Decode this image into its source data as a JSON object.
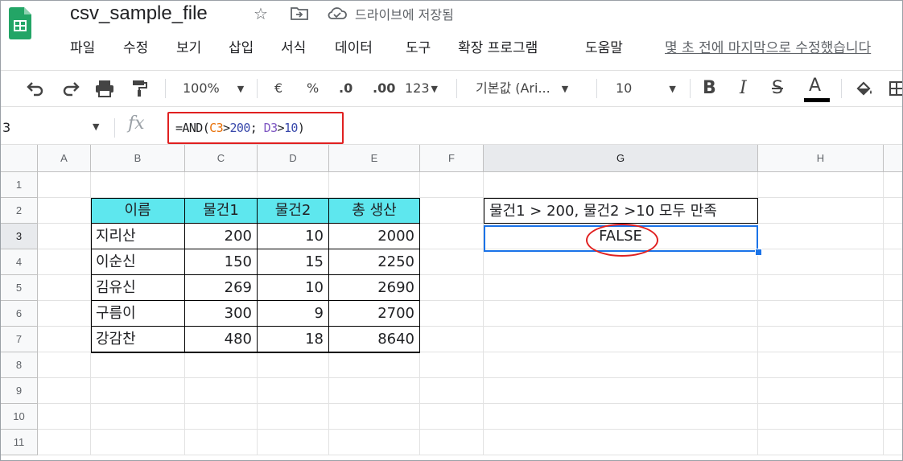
{
  "app": {
    "doc_title": "csv_sample_file",
    "save_status": "드라이브에 저장됨",
    "last_edit": "몇 초 전에 마지막으로 수정했습니다"
  },
  "menu": [
    "파일",
    "수정",
    "보기",
    "삽입",
    "서식",
    "데이터",
    "도구",
    "확장 프로그램",
    "도움말"
  ],
  "toolbar": {
    "zoom": "100%",
    "currency": "€",
    "percent": "%",
    "decrease_decimal": ".0",
    "increase_decimal": ".00",
    "number_format": "123",
    "font": "기본값 (Ari...",
    "font_size": "10",
    "bold": "B",
    "italic": "I",
    "strike": "S",
    "text_color": "A"
  },
  "formula_bar": {
    "name_box": "3",
    "fx": "fx",
    "formula_prefix": "=AND(",
    "ref1": "C3",
    "op1": ">",
    "num1": "200",
    "sep": "; ",
    "ref2": "D3",
    "op2": ">",
    "num2": "10",
    "suffix": ")"
  },
  "columns": [
    "A",
    "B",
    "C",
    "D",
    "E",
    "F",
    "G",
    "H"
  ],
  "rows": [
    "1",
    "2",
    "3",
    "4",
    "5",
    "6",
    "7",
    "8",
    "9",
    "10",
    "11"
  ],
  "table": {
    "headers": [
      "이름",
      "물건1",
      "물건2",
      "총 생산"
    ],
    "rows": [
      [
        "지리산",
        "200",
        "10",
        "2000"
      ],
      [
        "이순신",
        "150",
        "15",
        "2250"
      ],
      [
        "김유신",
        "269",
        "10",
        "2690"
      ],
      [
        "구름이",
        "300",
        "9",
        "2700"
      ],
      [
        "강감찬",
        "480",
        "18",
        "8640"
      ]
    ]
  },
  "g2": "물건1 > 200, 물건2 >10 모두 만족",
  "g3": "FALSE",
  "colors": {
    "header_fill": "#5ee7ee",
    "selection": "#1a73e8",
    "annotation": "#e02020"
  }
}
